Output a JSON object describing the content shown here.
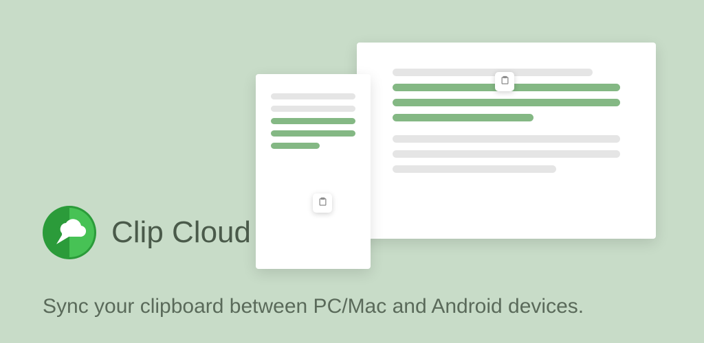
{
  "app": {
    "name": "Clip Cloud",
    "tagline": "Sync your clipboard between PC/Mac and Android devices."
  },
  "icons": {
    "logo": "cloud-logo-icon",
    "paste": "paste-icon"
  }
}
